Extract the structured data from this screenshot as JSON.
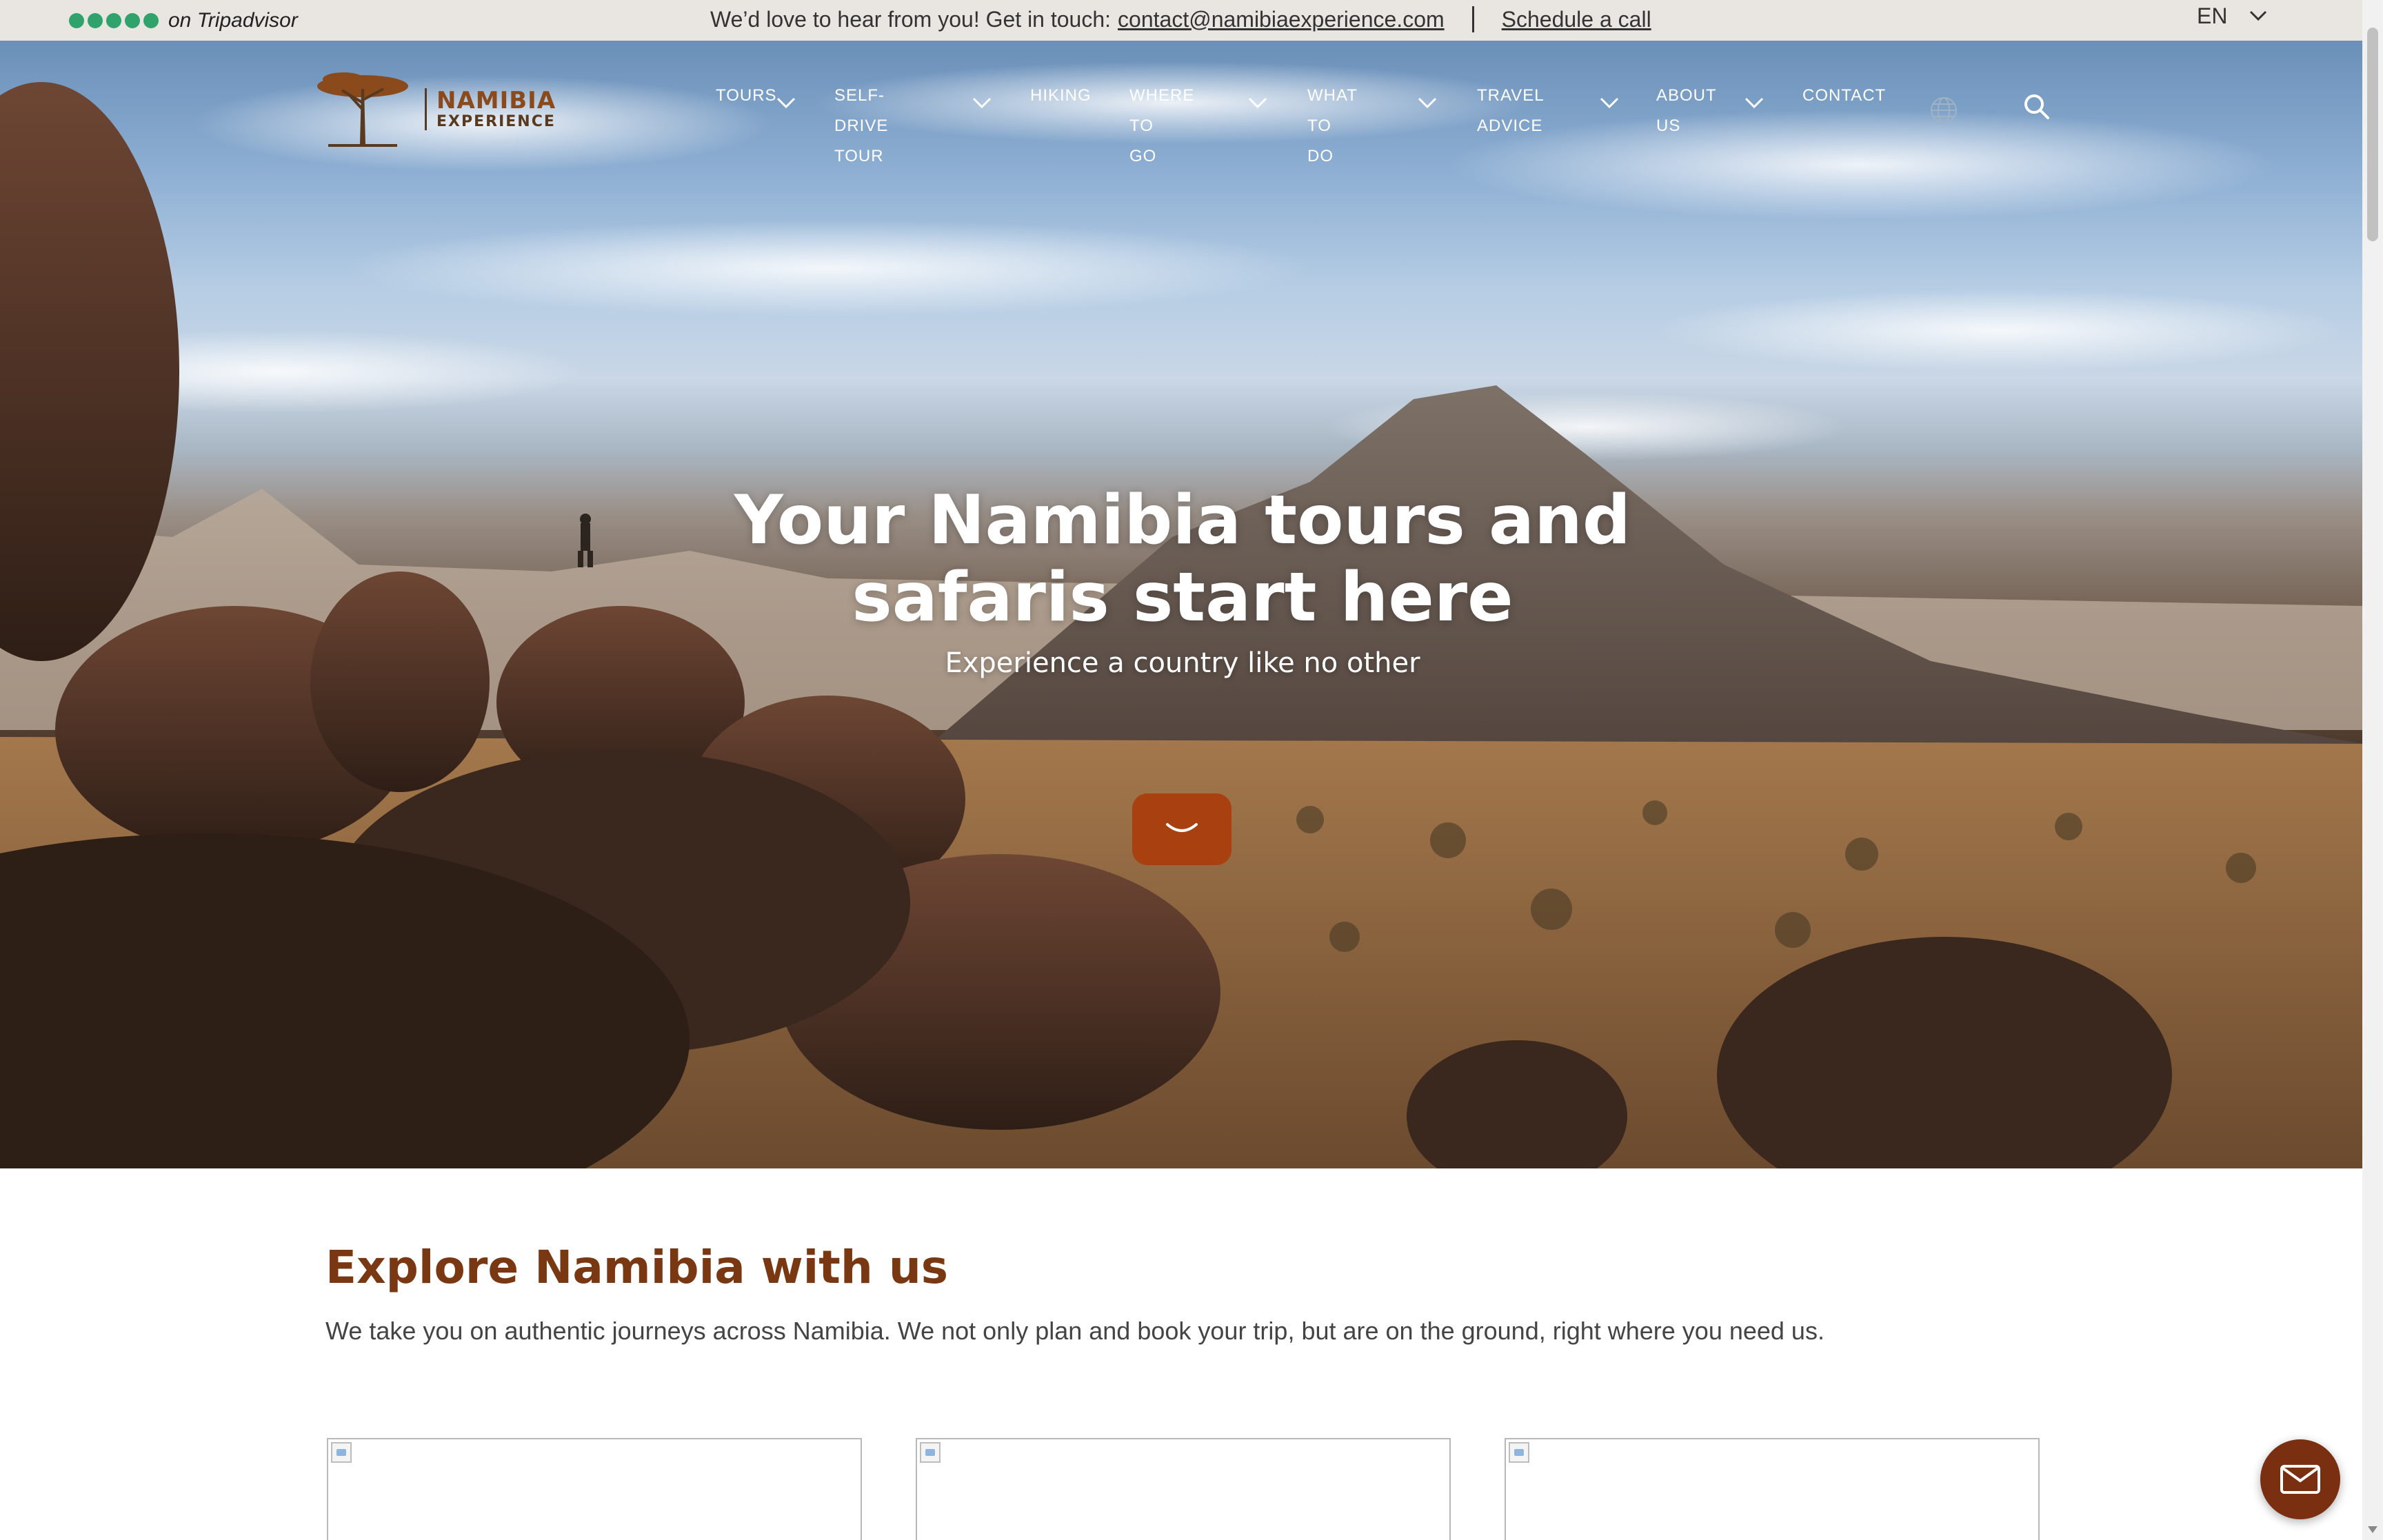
{
  "topbar": {
    "rating_text": "on Tripadvisor",
    "message": "We’d love to hear from you! Get in touch:",
    "email": "contact@namibiaexperience.com",
    "schedule": "Schedule a call",
    "language": "EN"
  },
  "logo": {
    "line1": "NAMIBIA",
    "line2": "EXPERIENCE"
  },
  "nav": [
    {
      "label": "TOURS"
    },
    {
      "label": "SELF-DRIVE\nTOUR"
    },
    {
      "label": "HIKING"
    },
    {
      "label": "WHERE TO\nGO"
    },
    {
      "label": "WHAT TO\nDO"
    },
    {
      "label": "TRAVEL\nADVICE"
    },
    {
      "label": "ABOUT\nUS"
    },
    {
      "label": "CONTACT"
    }
  ],
  "hero": {
    "title": "Your Namibia tours and safaris start here",
    "subtitle": "Experience a country like no other"
  },
  "intro": {
    "title": "Explore Namibia with us",
    "text": "We take you on authentic journeys across Namibia. We not only plan and book your trip, but are on the ground, right where you need us."
  },
  "colors": {
    "accent": "#a8410f",
    "heading": "#7a3812",
    "rating_green": "#2fa36b",
    "topbar_bg": "#e9e6e2"
  },
  "icons": [
    "chevron-down-icon",
    "globe-icon",
    "search-icon",
    "mail-icon",
    "acacia-tree-icon"
  ]
}
